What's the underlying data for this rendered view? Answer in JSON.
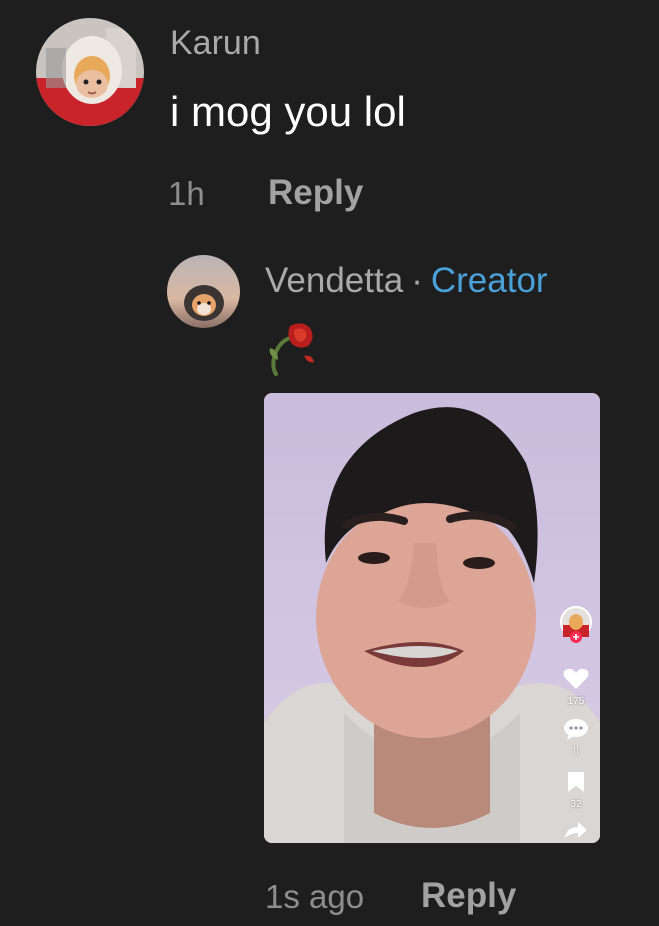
{
  "comment": {
    "author": "Karun",
    "text": "i mog you lol",
    "time": "1h",
    "reply_label": "Reply"
  },
  "reply": {
    "author": "Vendetta",
    "separator": "·",
    "badge": "Creator",
    "sticker": "wilted-rose",
    "time": "1s ago",
    "reply_label": "Reply",
    "video": {
      "like_count": "175",
      "comment_count": "8",
      "save_count": "32"
    }
  },
  "colors": {
    "background": "#1e1e1e",
    "creator_badge": "#4aa0d8",
    "meta_text": "#8e8e8e"
  }
}
